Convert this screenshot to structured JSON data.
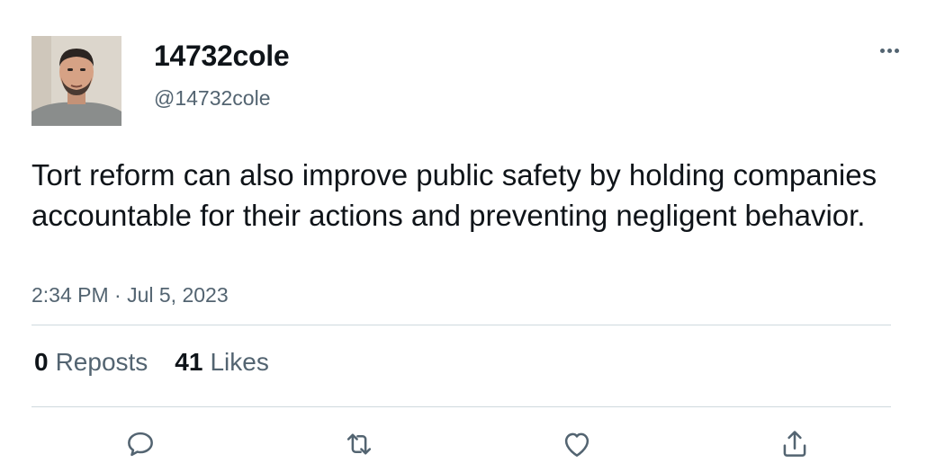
{
  "author": {
    "display_name": "14732cole",
    "handle": "@14732cole"
  },
  "tweet": {
    "text": "Tort reform can also improve public safety by holding companies accountable for their actions and preventing negligent behavior.",
    "timestamp": "2:34 PM · Jul 5, 2023"
  },
  "stats": {
    "reposts_count": "0",
    "reposts_label": "Reposts",
    "likes_count": "41",
    "likes_label": "Likes"
  },
  "actions": {
    "icons": [
      "reply-icon",
      "repost-icon",
      "like-icon",
      "share-icon"
    ]
  },
  "colors": {
    "text": "#0f1419",
    "secondary": "#536471",
    "divider": "#cfd9de"
  }
}
